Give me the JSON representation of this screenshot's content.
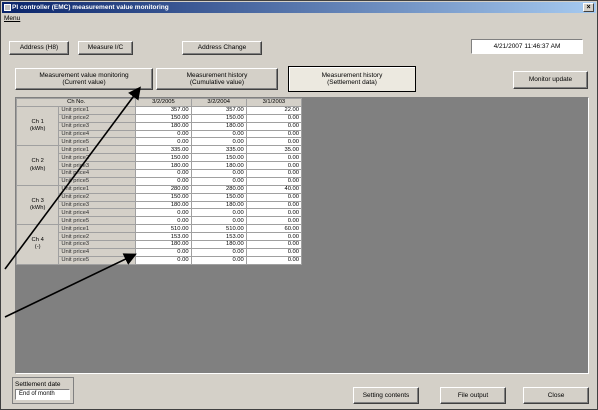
{
  "window": {
    "title": "PI controller (EMC) measurement value monitoring",
    "menu": "Menu"
  },
  "toolbar": {
    "address_label": "Address (H8)",
    "measure_label": "Measure I/C",
    "address_change_label": "Address Change",
    "datetime": "4/21/2007 11:46:37 AM"
  },
  "tabs": [
    {
      "line1": "Measurement value monitoring",
      "line2": "(Current value)"
    },
    {
      "line1": "Measurement history",
      "line2": "(Cumulative value)"
    },
    {
      "line1": "Measurement history",
      "line2": "(Settlement data)"
    }
  ],
  "monitor_update_label": "Monitor update",
  "grid": {
    "header": [
      "Ch No.",
      "3/2/2005",
      "3/2/2004",
      "3/1/2003"
    ],
    "groups": [
      {
        "ch": "Ch 1",
        "unit_sym": "(kWh)",
        "rows": [
          {
            "unit": "Unit price1",
            "v": [
              "357.00",
              "357.00",
              "22.00"
            ]
          },
          {
            "unit": "Unit price2",
            "v": [
              "150.00",
              "150.00",
              "0.00"
            ]
          },
          {
            "unit": "Unit price3",
            "v": [
              "180.00",
              "180.00",
              "0.00"
            ]
          },
          {
            "unit": "Unit price4",
            "v": [
              "0.00",
              "0.00",
              "0.00"
            ]
          },
          {
            "unit": "Unit price5",
            "v": [
              "0.00",
              "0.00",
              "0.00"
            ]
          }
        ]
      },
      {
        "ch": "Ch 2",
        "unit_sym": "(kWh)",
        "rows": [
          {
            "unit": "Unit price1",
            "v": [
              "335.00",
              "335.00",
              "35.00"
            ]
          },
          {
            "unit": "Unit price2",
            "v": [
              "150.00",
              "150.00",
              "0.00"
            ]
          },
          {
            "unit": "Unit price3",
            "v": [
              "180.00",
              "180.00",
              "0.00"
            ]
          },
          {
            "unit": "Unit price4",
            "v": [
              "0.00",
              "0.00",
              "0.00"
            ]
          },
          {
            "unit": "Unit price5",
            "v": [
              "0.00",
              "0.00",
              "0.00"
            ]
          }
        ]
      },
      {
        "ch": "Ch 3",
        "unit_sym": "(kWh)",
        "rows": [
          {
            "unit": "Unit price1",
            "v": [
              "280.00",
              "280.00",
              "40.00"
            ]
          },
          {
            "unit": "Unit price2",
            "v": [
              "150.00",
              "150.00",
              "0.00"
            ]
          },
          {
            "unit": "Unit price3",
            "v": [
              "180.00",
              "180.00",
              "0.00"
            ]
          },
          {
            "unit": "Unit price4",
            "v": [
              "0.00",
              "0.00",
              "0.00"
            ]
          },
          {
            "unit": "Unit price5",
            "v": [
              "0.00",
              "0.00",
              "0.00"
            ]
          }
        ]
      },
      {
        "ch": "Ch 4",
        "unit_sym": "(-)",
        "rows": [
          {
            "unit": "Unit price1",
            "v": [
              "510.00",
              "510.00",
              "60.00"
            ]
          },
          {
            "unit": "Unit price2",
            "v": [
              "153.00",
              "153.00",
              "0.00"
            ]
          },
          {
            "unit": "Unit price3",
            "v": [
              "180.00",
              "180.00",
              "0.00"
            ]
          },
          {
            "unit": "Unit price4",
            "v": [
              "0.00",
              "0.00",
              "0.00"
            ]
          },
          {
            "unit": "Unit price5",
            "v": [
              "0.00",
              "0.00",
              "0.00"
            ]
          }
        ]
      }
    ]
  },
  "settlement": {
    "label": "Settlement date",
    "value": "End of month"
  },
  "bottom": {
    "setting_contents": "Setting contents",
    "file_output": "File output",
    "close": "Close"
  },
  "colors": {
    "title_start": "#0a246a",
    "title_end": "#a6caf0",
    "face": "#d4d0c8",
    "empty_area": "#808080"
  },
  "icons": {
    "app": "app-icon",
    "close": "close-icon"
  }
}
